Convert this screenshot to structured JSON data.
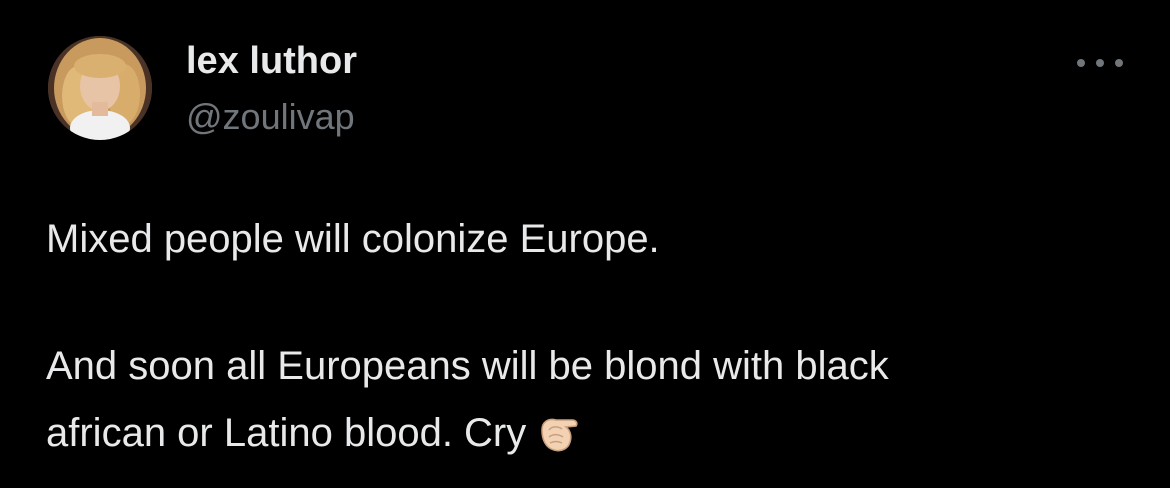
{
  "tweet": {
    "author_name": "lex luthor",
    "author_handle": "@zoulivap",
    "text_line_1": "Mixed people will colonize Europe.",
    "text_line_2": "And soon all Europeans will be blond with black",
    "text_line_3": "african or Latino blood. Cry",
    "emoji_icon": "pointing-finger-icon",
    "more_icon": "more-options-icon"
  },
  "colors": {
    "background": "#000000",
    "primary_text": "#e7e9ea",
    "secondary_text": "#71767b"
  }
}
